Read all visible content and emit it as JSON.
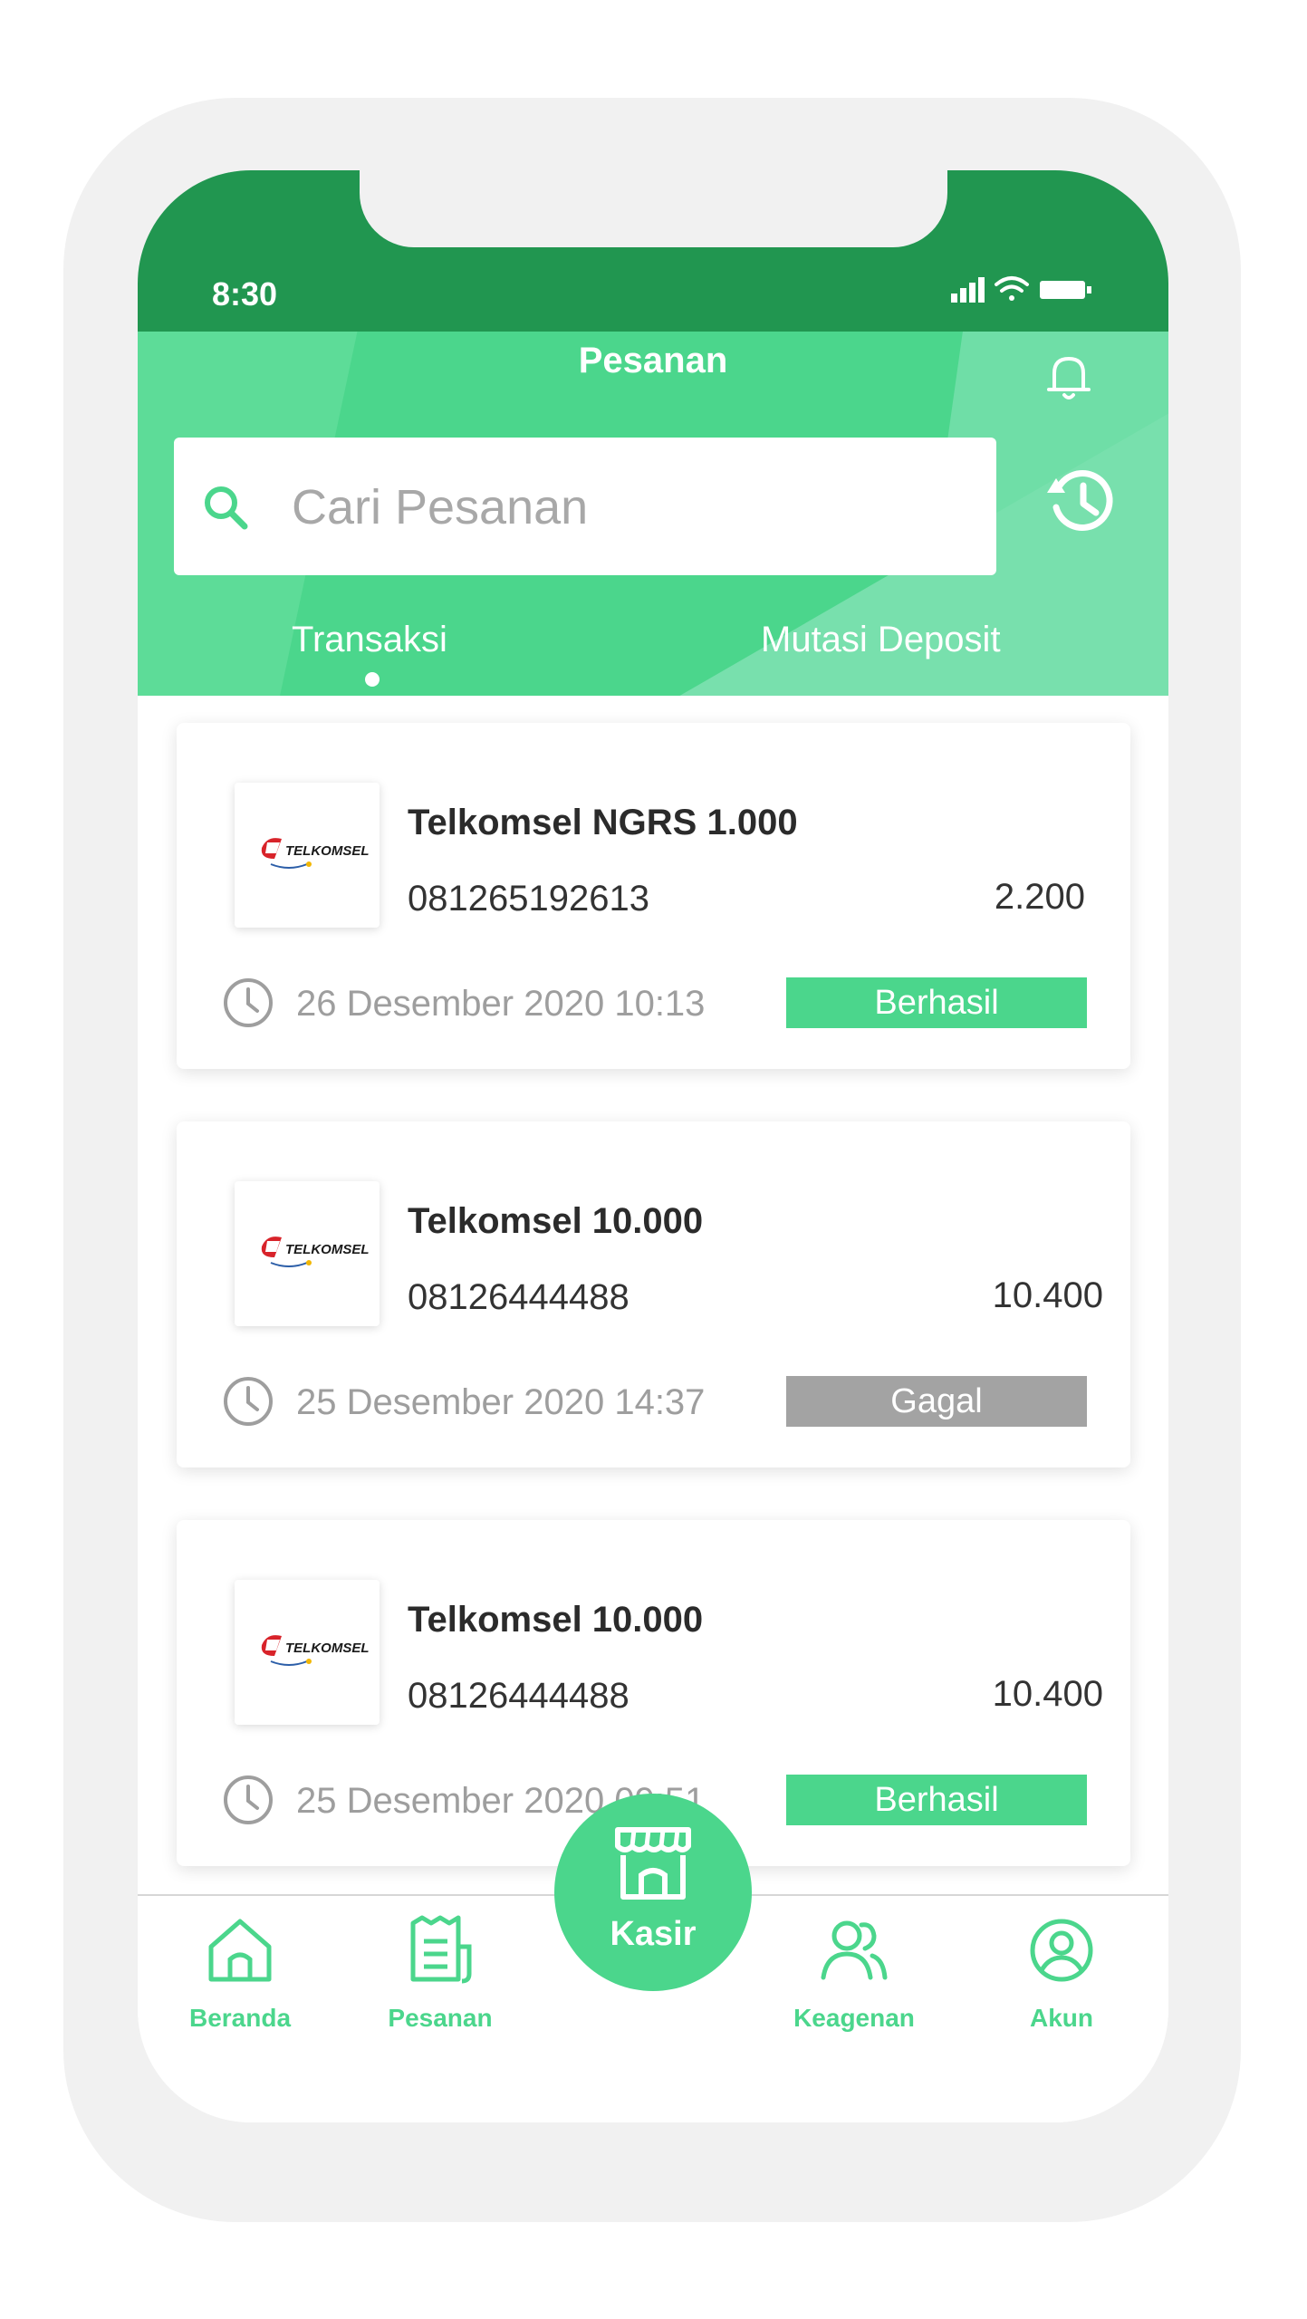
{
  "status_bar": {
    "time": "8:30"
  },
  "header": {
    "title": "Pesanan",
    "search": {
      "placeholder": "Cari Pesanan",
      "value": ""
    },
    "tabs": [
      {
        "label": "Transaksi",
        "active": true
      },
      {
        "label": "Mutasi Deposit",
        "active": false
      }
    ]
  },
  "orders": [
    {
      "logo_text": "TELKOMSEL",
      "product": "Telkomsel NGRS 1.000",
      "phone": "081265192613",
      "price": "2.200",
      "datetime": "26 Desember 2020 10:13",
      "status": "Berhasil"
    },
    {
      "logo_text": "TELKOMSEL",
      "product": "Telkomsel 10.000",
      "phone": "08126444488",
      "price": "10.400",
      "datetime": "25 Desember 2020 14:37",
      "status": "Gagal"
    },
    {
      "logo_text": "TELKOMSEL",
      "product": "Telkomsel 10.000",
      "phone": "08126444488",
      "price": "10.400",
      "datetime": "25 Desember 2020 09:51",
      "status": "Berhasil"
    }
  ],
  "bottom_nav": {
    "items": [
      {
        "label": "Beranda",
        "icon": "home-icon"
      },
      {
        "label": "Pesanan",
        "icon": "receipt-icon"
      },
      {
        "label": "Kasir",
        "icon": "store-icon"
      },
      {
        "label": "Keagenan",
        "icon": "users-icon"
      },
      {
        "label": "Akun",
        "icon": "account-icon"
      }
    ]
  },
  "colors": {
    "primary_green": "#4bd68c",
    "dark_green": "#219650",
    "status_success": "#4bd68c",
    "status_failed": "#a3a3a3"
  }
}
